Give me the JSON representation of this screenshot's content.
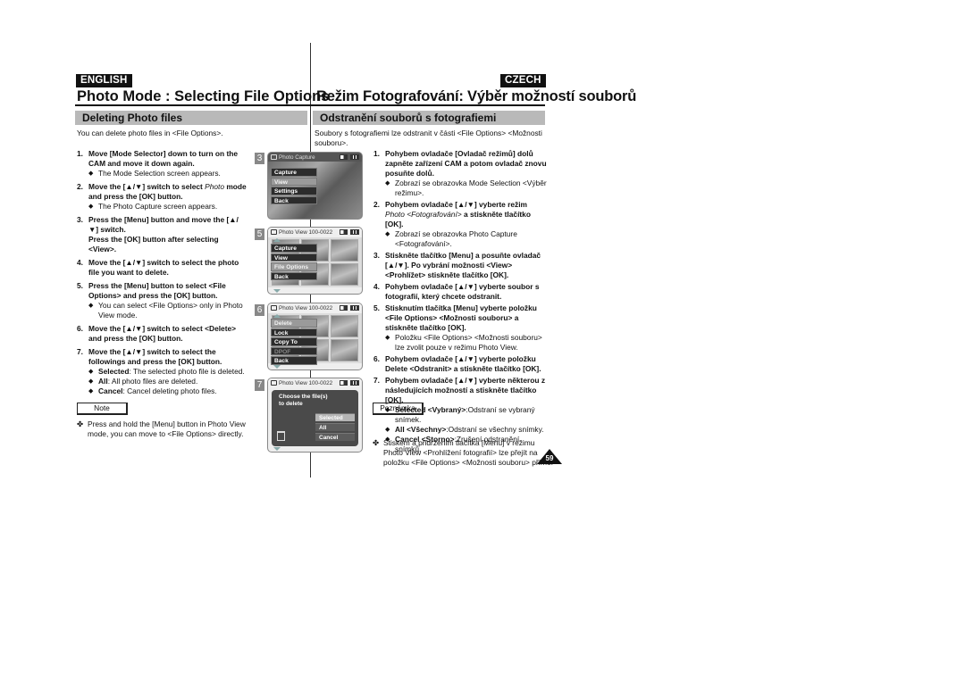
{
  "english": {
    "lang_label": "ENGLISH",
    "title": "Photo Mode : Selecting File Options",
    "section": "Deleting Photo files",
    "intro": "You can delete photo files in <File Options>.",
    "steps": [
      {
        "num": "1.",
        "text": "Move [Mode Selector] down to turn on the CAM and move it down again.",
        "bullets": [
          "The Mode Selection screen appears."
        ]
      },
      {
        "num": "2.",
        "text_a": "Move the [▲/▼] switch to select ",
        "text_italic": "Photo",
        "text_b": " mode and press the [OK] button.",
        "bullets": [
          "The Photo Capture screen appears."
        ]
      },
      {
        "num": "3.",
        "text": "Press the [Menu] button and move the [▲/▼] switch.",
        "text2": "Press the [OK] button after selecting <View>.",
        "bullets": []
      },
      {
        "num": "4.",
        "text": "Move the [▲/▼] switch to select the photo file you want to delete.",
        "bullets": []
      },
      {
        "num": "5.",
        "text": "Press the [Menu] button to select <File Options> and press the [OK] button.",
        "bullets": [
          "You can select <File Options> only in Photo View mode."
        ]
      },
      {
        "num": "6.",
        "text": "Move the [▲/▼] switch to select <Delete> and press the [OK] button.",
        "bullets": []
      },
      {
        "num": "7.",
        "text": "Move the [▲/▼] switch to select the followings and press the [OK] button.",
        "bullets_rich": [
          {
            "bold": "Selected",
            "rest": ": The selected photo file is deleted."
          },
          {
            "bold": "All",
            "rest": ": All photo files are deleted."
          },
          {
            "bold": "Cancel",
            "rest": ": Cancel deleting photo files."
          }
        ]
      }
    ],
    "note_label": "Note",
    "note_text": "Press and hold the [Menu] button in Photo View mode, you can move to <File Options> directly."
  },
  "czech": {
    "lang_label": "CZECH",
    "title": "Režim Fotografování: Výběr možností souborů",
    "section": "Odstranění souborů s fotografiemi",
    "intro": "Soubory s fotografiemi lze odstranit v části <File Options> <Možnosti souboru>.",
    "steps": [
      {
        "num": "1.",
        "text": "Pohybem ovladače [Ovladač režimů] dolů zapněte zařízení CAM a potom ovladač znovu posuňte dolů.",
        "bullets": [
          "Zobrazí se obrazovka Mode Selection <Výběr režimu>."
        ]
      },
      {
        "num": "2.",
        "text_a": "Pohybem ovladače [▲/▼] vyberte režim ",
        "text_italic": "Photo <Fotografování>",
        "text_b": " a stiskněte tlačítko [OK].",
        "bullets": [
          "Zobrazí se obrazovka Photo Capture <Fotografování>."
        ]
      },
      {
        "num": "3.",
        "text": "Stiskněte tlačítko [Menu] a posuňte ovladač [▲/▼]. Po vybrání možnosti <View> <Prohlížet> stiskněte tlačítko [OK].",
        "bullets": []
      },
      {
        "num": "4.",
        "text": "Pohybem ovladače [▲/▼] vyberte soubor s fotografií, který chcete odstranit.",
        "bullets": []
      },
      {
        "num": "5.",
        "text": "Stisknutím tlačítka [Menu] vyberte položku <File Options> <Možnosti souboru> a stiskněte tlačítko [OK].",
        "bullets": [
          "Položku <File Options> <Možnosti souboru> lze zvolit pouze v režimu Photo View."
        ]
      },
      {
        "num": "6.",
        "text": "Pohybem ovladače [▲/▼] vyberte položku Delete <Odstranit> a stiskněte tlačítko [OK].",
        "bullets": []
      },
      {
        "num": "7.",
        "text": "Pohybem ovladače [▲/▼] vyberte některou z následujících možností a stiskněte tlačítko [OK].",
        "bullets_rich": [
          {
            "bold": "Selected <Vybraný>",
            "rest": ":Odstraní se vybraný snímek."
          },
          {
            "bold": "All <Všechny>",
            "rest": ":Odstraní se všechny snímky."
          },
          {
            "bold": "Cancel <Storno>",
            "rest": ":Zrušení odstranění snímků."
          }
        ]
      }
    ],
    "note_label": "Poznámka",
    "note_text": "Stiskem a přidržením tlačítka [Menu] v režimu Photo View <Prohlížení fotografií> lze přejít na položku <File Options> <Možnosti souboru> přímo."
  },
  "screens": [
    {
      "step": "3",
      "header": "Photo Capture",
      "menu": [
        "Capture",
        "View",
        "Settings",
        "Back"
      ],
      "selected": "View"
    },
    {
      "step": "5",
      "header": "Photo View  100-0022",
      "menu": [
        "Capture",
        "View",
        "File Options",
        "Back"
      ],
      "selected": "File Options"
    },
    {
      "step": "6",
      "header": "Photo View  100-0022",
      "menu": [
        "Delete",
        "Lock",
        "Copy To",
        "DPOF",
        "Back"
      ],
      "selected": "Delete",
      "disabled": "DPOF"
    },
    {
      "step": "7",
      "header": "Photo View  100-0022",
      "prompt_line1": "Choose the file(s)",
      "prompt_line2": "to delete",
      "options": [
        "Selected",
        "All",
        "Cancel"
      ],
      "selected": "Selected"
    }
  ],
  "page_number": "59",
  "icons": {
    "bullet": "◆",
    "note_marker": "✤",
    "camera": "camera-icon",
    "battery": "battery-icon",
    "trash": "trash-icon"
  }
}
